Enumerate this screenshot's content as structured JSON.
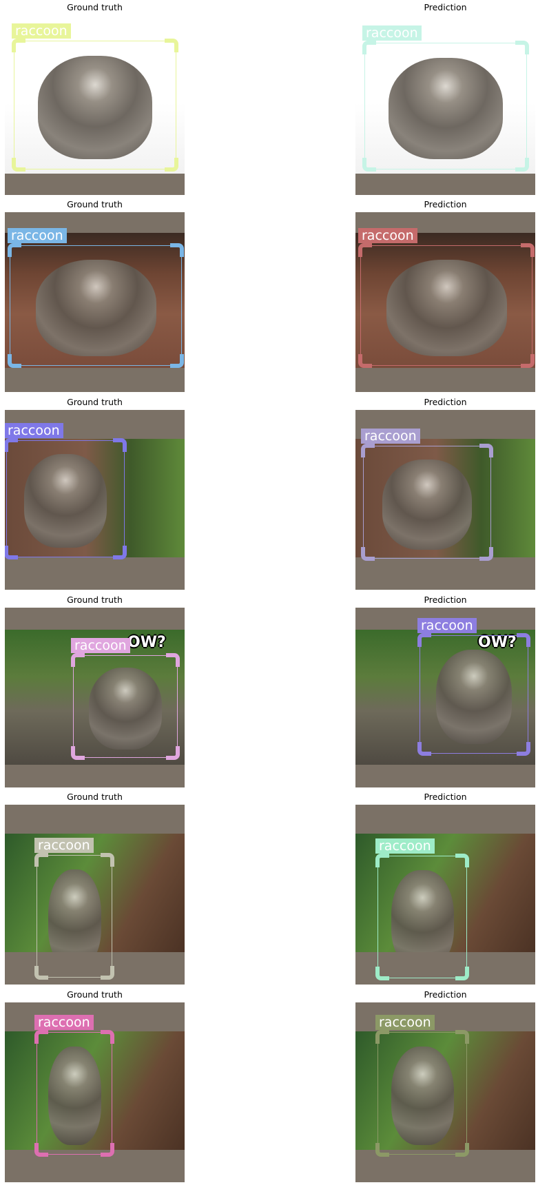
{
  "titles": {
    "left": "Ground truth",
    "right": "Prediction"
  },
  "rows": [
    {
      "label": "raccoon",
      "gt_color": "#e8f59a",
      "pred_color": "#c6f4e6",
      "meme_text": ""
    },
    {
      "label": "raccoon",
      "gt_color": "#7ab6e6",
      "pred_color": "#c56b6b",
      "meme_text": ""
    },
    {
      "label": "raccoon",
      "gt_color": "#7f78e8",
      "pred_color": "#a99ed0",
      "meme_text": ""
    },
    {
      "label": "raccoon",
      "gt_color": "#e0a6df",
      "pred_color": "#8d7ee0",
      "meme_text": "OW?"
    },
    {
      "label": "raccoon",
      "gt_color": "#c2c2b0",
      "pred_color": "#9eecc8",
      "meme_text": ""
    },
    {
      "label": "raccoon",
      "gt_color": "#dd6fb1",
      "pred_color": "#8c9966",
      "meme_text": ""
    }
  ]
}
